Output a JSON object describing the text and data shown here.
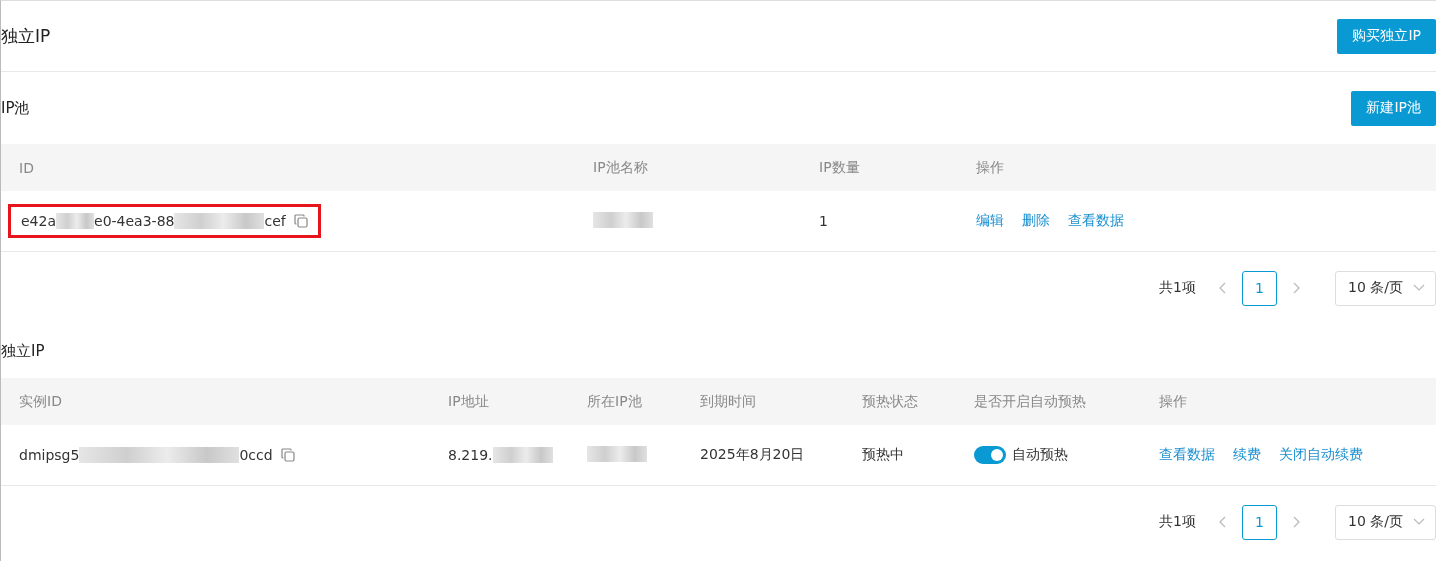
{
  "page": {
    "title": "独立IP",
    "action": "购买独立IP"
  },
  "pool_section": {
    "title": "IP池",
    "action": "新建IP池",
    "columns": [
      "ID",
      "IP池名称",
      "IP数量",
      "操作"
    ],
    "rows": [
      {
        "highlighted": true,
        "id": [
          {
            "kind": "text",
            "text": "e42a"
          },
          {
            "kind": "blur"
          },
          {
            "kind": "text",
            "text": "e0-4ea3-88"
          },
          {
            "kind": "blur"
          },
          {
            "kind": "text",
            "text": "cef"
          }
        ],
        "name": [
          {
            "kind": "blur"
          }
        ],
        "count": "1",
        "actions": [
          "编辑",
          "删除",
          "查看数据"
        ]
      }
    ],
    "pagination": {
      "total": "共1项",
      "pages": [
        {
          "label": "1",
          "selected": true
        }
      ],
      "page_size": "10 条/页"
    }
  },
  "ip_section": {
    "title": "独立IP",
    "columns": [
      "实例ID",
      "IP地址",
      "所在IP池",
      "到期时间",
      "预热状态",
      "是否开启自动预热",
      "操作"
    ],
    "rows": [
      {
        "id": [
          {
            "kind": "text",
            "text": "dmipsg5"
          },
          {
            "kind": "blur"
          },
          {
            "kind": "text",
            "text": "0ccd"
          }
        ],
        "address": [
          {
            "kind": "text",
            "text": "8.219."
          },
          {
            "kind": "blur"
          }
        ],
        "pool": [
          {
            "kind": "blur"
          }
        ],
        "expires": "2025年8月20日",
        "warmup_status": "预热中",
        "auto_warmup": {
          "on": true,
          "label": "自动预热"
        },
        "actions": [
          "查看数据",
          "续费",
          "关闭自动续费"
        ]
      }
    ],
    "pagination": {
      "total": "共1项",
      "pages": [
        {
          "label": "1",
          "selected": true
        }
      ],
      "page_size": "10 条/页"
    }
  }
}
